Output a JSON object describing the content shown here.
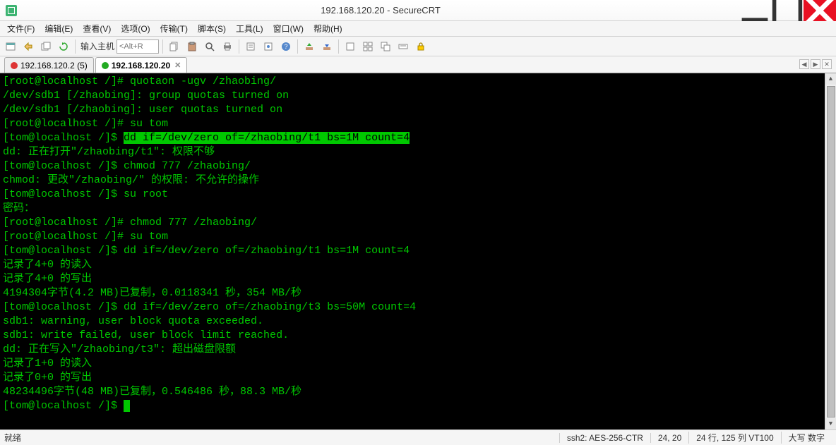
{
  "window": {
    "title": "192.168.120.20 - SecureCRT"
  },
  "menu": {
    "file": "文件(F)",
    "edit": "编辑(E)",
    "view": "查看(V)",
    "options": "选项(O)",
    "transfer": "传输(T)",
    "script": "脚本(S)",
    "tools": "工具(L)",
    "window": "窗口(W)",
    "help": "帮助(H)"
  },
  "toolbar": {
    "host_label": "输入主机",
    "host_placeholder": "<Alt+R"
  },
  "tabs": [
    {
      "label": "192.168.120.2 (5)",
      "status": "red",
      "active": false
    },
    {
      "label": "192.168.120.20",
      "status": "green",
      "active": true
    }
  ],
  "term": {
    "l1_prompt": "[root@localhost /]# ",
    "l1_cmd": "quotaon -ugv /zhaobing/",
    "l2": "/dev/sdb1 [/zhaobing]: group quotas turned on",
    "l3": "/dev/sdb1 [/zhaobing]: user quotas turned on",
    "l4_prompt": "[root@localhost /]# ",
    "l4_cmd": "su tom",
    "l5_prompt": "[tom@localhost /]$ ",
    "l5_cmd": "dd if=/dev/zero of=/zhaobing/t1 bs=1M count=4",
    "l6": "dd: 正在打开\"/zhaobing/t1\": 权限不够",
    "l7_prompt": "[tom@localhost /]$ ",
    "l7_cmd": "chmod 777 /zhaobing/",
    "l8": "chmod: 更改\"/zhaobing/\" 的权限: 不允许的操作",
    "l9_prompt": "[tom@localhost /]$ ",
    "l9_cmd": "su root",
    "l10": "密码：",
    "l11_prompt": "[root@localhost /]# ",
    "l11_cmd": "chmod 777 /zhaobing/",
    "l12_prompt": "[root@localhost /]# ",
    "l12_cmd": "su tom",
    "l13_prompt": "[tom@localhost /]$ ",
    "l13_cmd": "dd if=/dev/zero of=/zhaobing/t1 bs=1M count=4",
    "l14": "记录了4+0 的读入",
    "l15": "记录了4+0 的写出",
    "l16": "4194304字节(4.2 MB)已复制，0.0118341 秒，354 MB/秒",
    "l17_prompt": "[tom@localhost /]$ ",
    "l17_cmd": "dd if=/dev/zero of=/zhaobing/t3 bs=50M count=4",
    "l18": "sdb1: warning, user block quota exceeded.",
    "l19": "sdb1: write failed, user block limit reached.",
    "l20": "dd: 正在写入\"/zhaobing/t3\": 超出磁盘限额",
    "l21": "记录了1+0 的读入",
    "l22": "记录了0+0 的写出",
    "l23": "48234496字节(48 MB)已复制，0.546486 秒，88.3 MB/秒",
    "l24_prompt": "[tom@localhost /]$ "
  },
  "status": {
    "ready": "就绪",
    "conn": "ssh2: AES-256-CTR",
    "cursor": "24, 20",
    "size": "24 行, 125 列 VT100",
    "caps": "大写 数字"
  }
}
